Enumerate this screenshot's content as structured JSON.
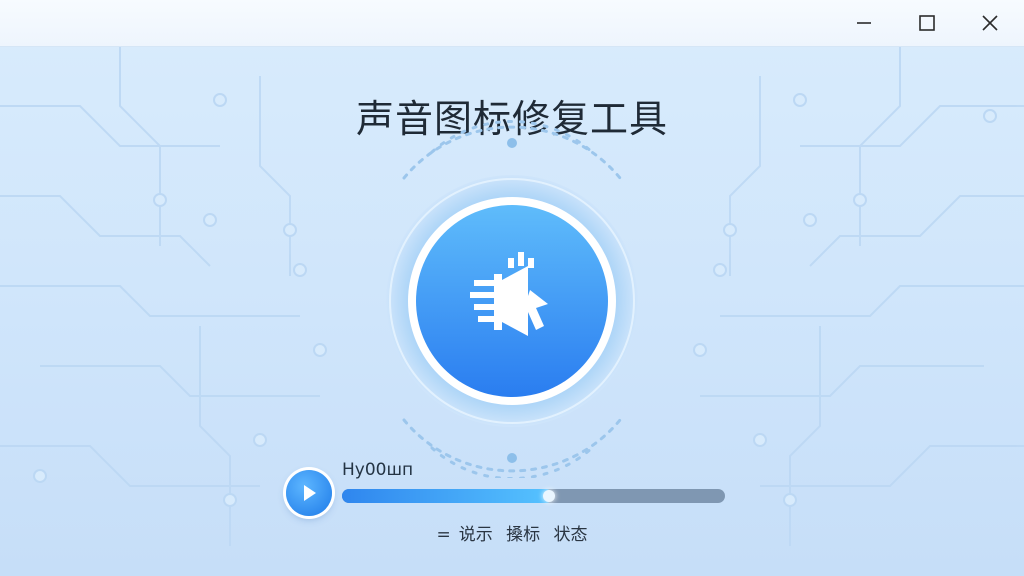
{
  "window": {
    "controls": {
      "minimize_icon": "minimize-icon",
      "maximize_icon": "maximize-icon",
      "close_icon": "close-icon"
    }
  },
  "main": {
    "title": "声音图标修复工具",
    "center_icon": "speaker-repair-icon"
  },
  "player": {
    "play_icon": "play-icon",
    "track_label": "Hy00шп",
    "progress": 0.55
  },
  "status": {
    "prefix": "=",
    "words": [
      "说示",
      "搡标",
      "状态"
    ]
  },
  "colors": {
    "accent": "#2a85f0",
    "background": "#cfe5fb",
    "progress_track": "#7f97b2"
  }
}
